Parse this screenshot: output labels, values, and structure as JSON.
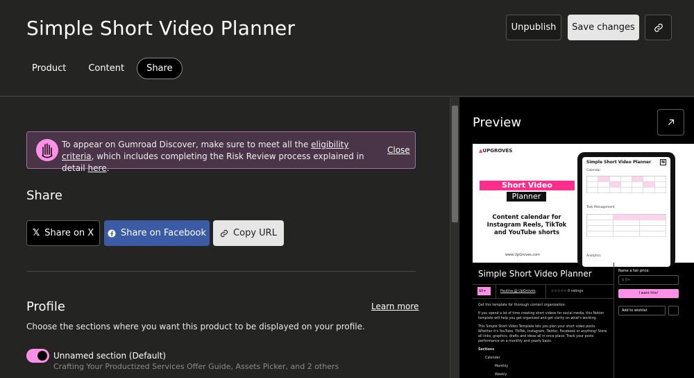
{
  "header": {
    "title": "Simple Short Video Planner",
    "unpublish_label": "Unpublish",
    "save_label": "Save changes",
    "link_icon": "link-icon"
  },
  "tabs": [
    {
      "label": "Product",
      "active": false
    },
    {
      "label": "Content",
      "active": false
    },
    {
      "label": "Share",
      "active": true
    }
  ],
  "notice": {
    "text_before": "To appear on Gumroad Discover, make sure to meet all the ",
    "link1": "eligibility criteria",
    "text_middle": ", which includes completing the Risk Review process explained in detail ",
    "link2": "here",
    "text_after": ".",
    "close_label": "Close",
    "bg_color": "#4a3447"
  },
  "share": {
    "title": "Share",
    "x_label": "Share on X",
    "facebook_label": "Share on Facebook",
    "copy_label": "Copy URL",
    "facebook_color": "#3b5ba5"
  },
  "profile": {
    "title": "Profile",
    "learn_more": "Learn more",
    "description": "Choose the sections where you want this product to be displayed on your profile.",
    "section_label": "Unnamed section (Default)",
    "section_sub": "Crafting Your Productized Services Offer Guide, Assets Picker, and 2 others",
    "toggle_on": true,
    "accent_color": "#ff90e8"
  },
  "preview": {
    "title": "Preview",
    "open_icon": "arrow-up-right-icon",
    "cover": {
      "logo": "UPGROVES",
      "headline1": "Short Video",
      "headline2": "Planner",
      "subtitle": "Content calendar for Instagram Reels, TikTok and YouTube shorts",
      "url": "www.UpGroves.com",
      "tablet_title": "Simple Short Video Planner",
      "tablet_calendar": "Calendar",
      "tablet_task": "Task Management",
      "tablet_analytics": "Analytics"
    },
    "product_title": "Simple Short Video Planner",
    "price": "$0+",
    "creator": "Paulina @ UpGroves",
    "ratings": "☆☆☆☆☆ 0 ratings",
    "desc_p1": "Get this template for thorough content organization.",
    "desc_p2": "If you spend a lot of time creating short videos for social media, this Notion template will help you get organized and get clarity on what's working.",
    "desc_p3": "This Simple Short Video Template lets you plan your short video posts. Whether it's YouTube, TikTok, Instagram, Twitter, Facebook or anything! Store all links, graphics, drafts and ideas all in once place. Track your posts performance on a monthly and yearly basis.",
    "desc_sections": "Sections",
    "desc_calendar": "Calendar",
    "desc_monthly": "Monthly",
    "desc_weekly": "Weekly",
    "fair_price_label": "Name a fair price:",
    "price_placeholder": "0+",
    "want_label": "I want this!",
    "wishlist_label": "Add to wishlist"
  }
}
